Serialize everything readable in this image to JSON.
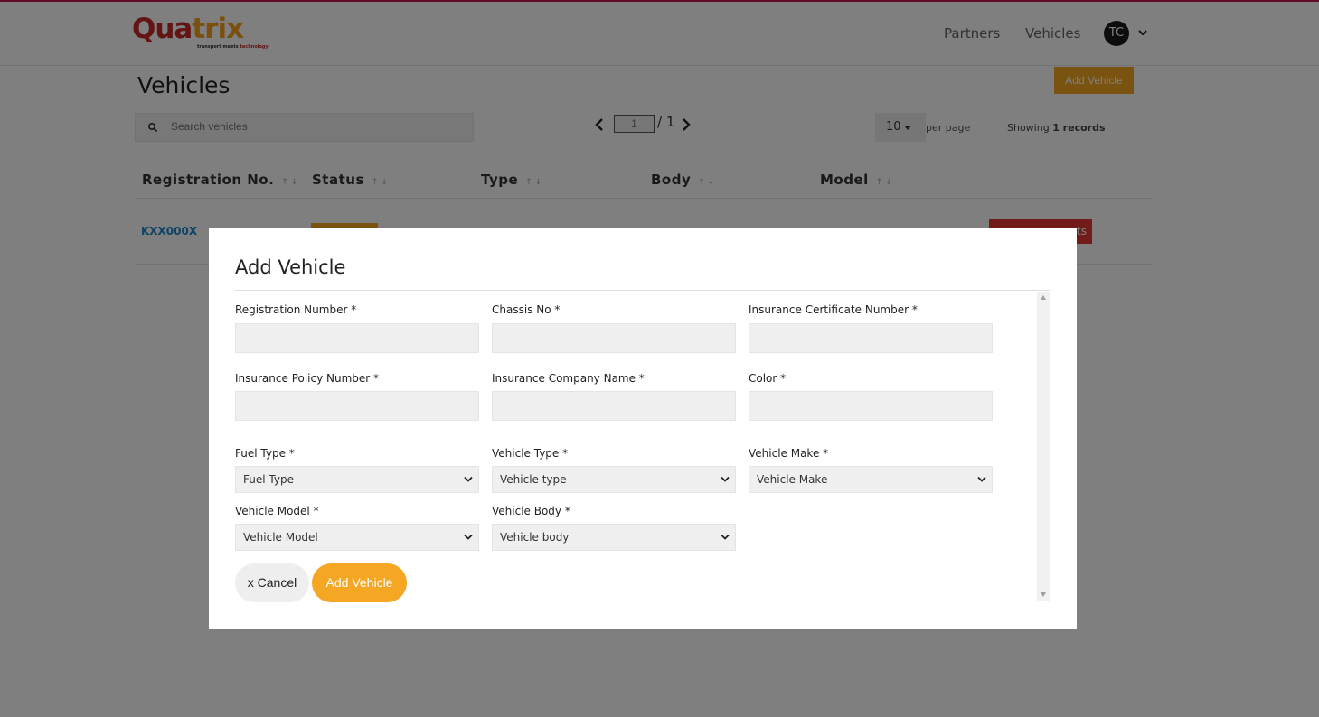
{
  "brand": {
    "logo_part1": "Qua",
    "logo_part2": "trix",
    "tagline_part1": "transport meets ",
    "tagline_part2": "technology",
    "primary_color": "#f5a623",
    "logo_red": "#c62828"
  },
  "nav": {
    "partners": "Partners",
    "vehicles": "Vehicles",
    "user_initials": "TC"
  },
  "page": {
    "title": "Vehicles",
    "add_button": "Add Vehicle",
    "search_placeholder": "Search vehicles",
    "current_page": "1",
    "total_pages": "/ 1",
    "per_page_value": "10",
    "per_page_label": "per page",
    "showing_prefix": "Showing",
    "showing_count": "1 records"
  },
  "table": {
    "columns": [
      "Registration No.",
      "Status",
      "Type",
      "Body",
      "Model"
    ],
    "rows": [
      {
        "registration": "KXX000X",
        "docs_button": "ts"
      }
    ]
  },
  "modal": {
    "title": "Add Vehicle",
    "fields": {
      "registration_number": "Registration Number *",
      "chassis_no": "Chassis No *",
      "insurance_certificate": "Insurance Certificate Number *",
      "insurance_policy": "Insurance Policy Number *",
      "insurance_company": "Insurance Company Name *",
      "color": "Color *",
      "fuel_type": "Fuel Type *",
      "vehicle_type": "Vehicle Type *",
      "vehicle_make": "Vehicle Make *",
      "vehicle_model": "Vehicle Model *",
      "vehicle_body": "Vehicle Body *"
    },
    "selects": {
      "fuel_type": "Fuel Type",
      "vehicle_type": "Vehicle type",
      "vehicle_make": "Vehicle Make",
      "vehicle_model": "Vehicle Model",
      "vehicle_body": "Vehicle body"
    },
    "cancel_label": "x Cancel",
    "submit_label": "Add Vehicle"
  }
}
